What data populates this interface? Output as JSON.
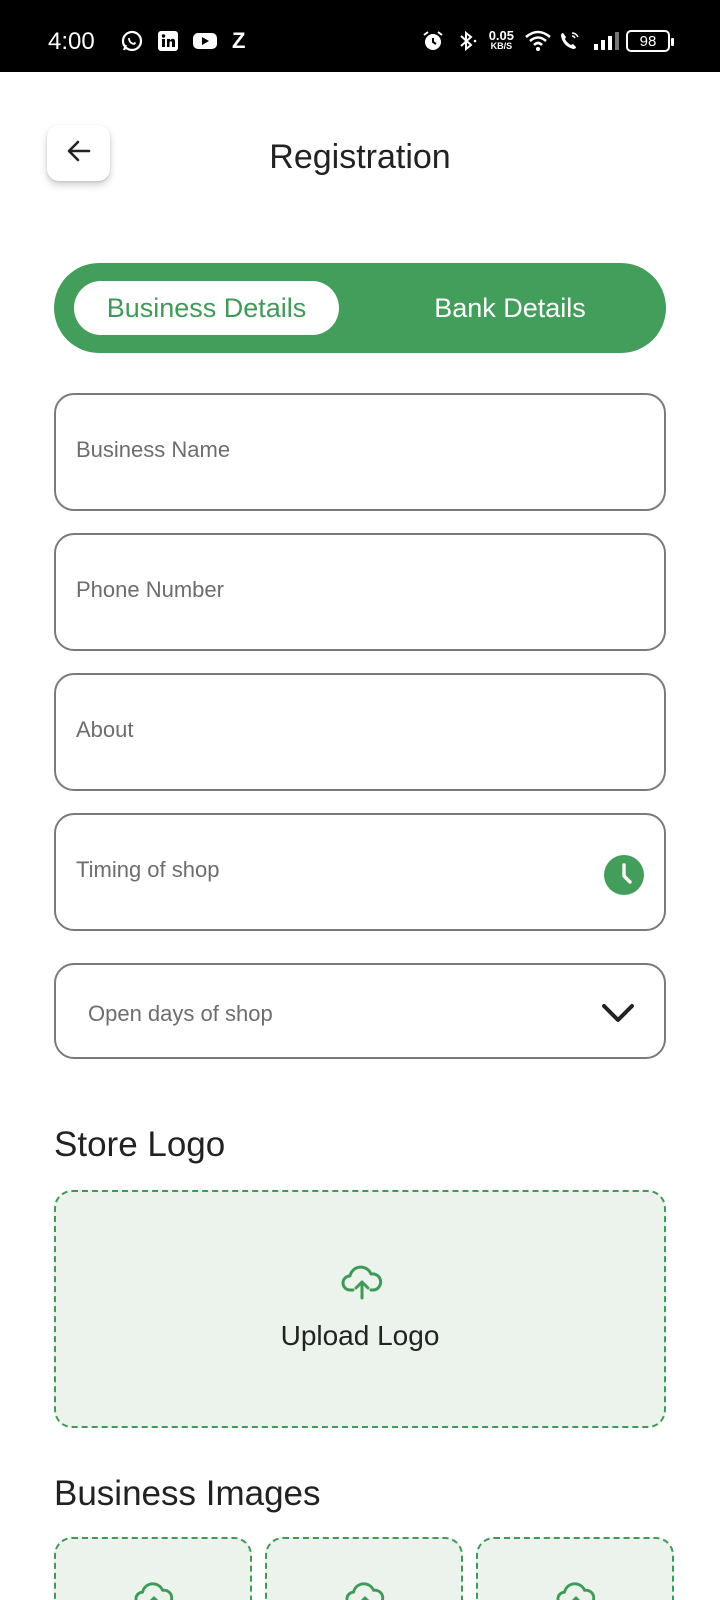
{
  "status_bar": {
    "time": "4:00",
    "left_icons": [
      "whatsapp-icon",
      "linkedin-icon",
      "youtube-icon",
      "z-app-icon"
    ],
    "z_label": "Z",
    "net_speed_value": "0.05",
    "net_speed_unit": "KB/S",
    "battery": "98"
  },
  "header": {
    "title": "Registration"
  },
  "tabs": [
    {
      "label": "Business Details",
      "active": true
    },
    {
      "label": "Bank Details",
      "active": false
    }
  ],
  "form": {
    "business_name_placeholder": "Business Name",
    "phone_placeholder": "Phone Number",
    "about_placeholder": "About",
    "timing_placeholder": "Timing of shop",
    "open_days_placeholder": "Open days of shop"
  },
  "store_logo": {
    "title": "Store Logo",
    "upload_label": "Upload Logo"
  },
  "business_images": {
    "title": "Business Images"
  },
  "colors": {
    "accent": "#439E5C",
    "upload_bg": "#EBF3EC"
  }
}
